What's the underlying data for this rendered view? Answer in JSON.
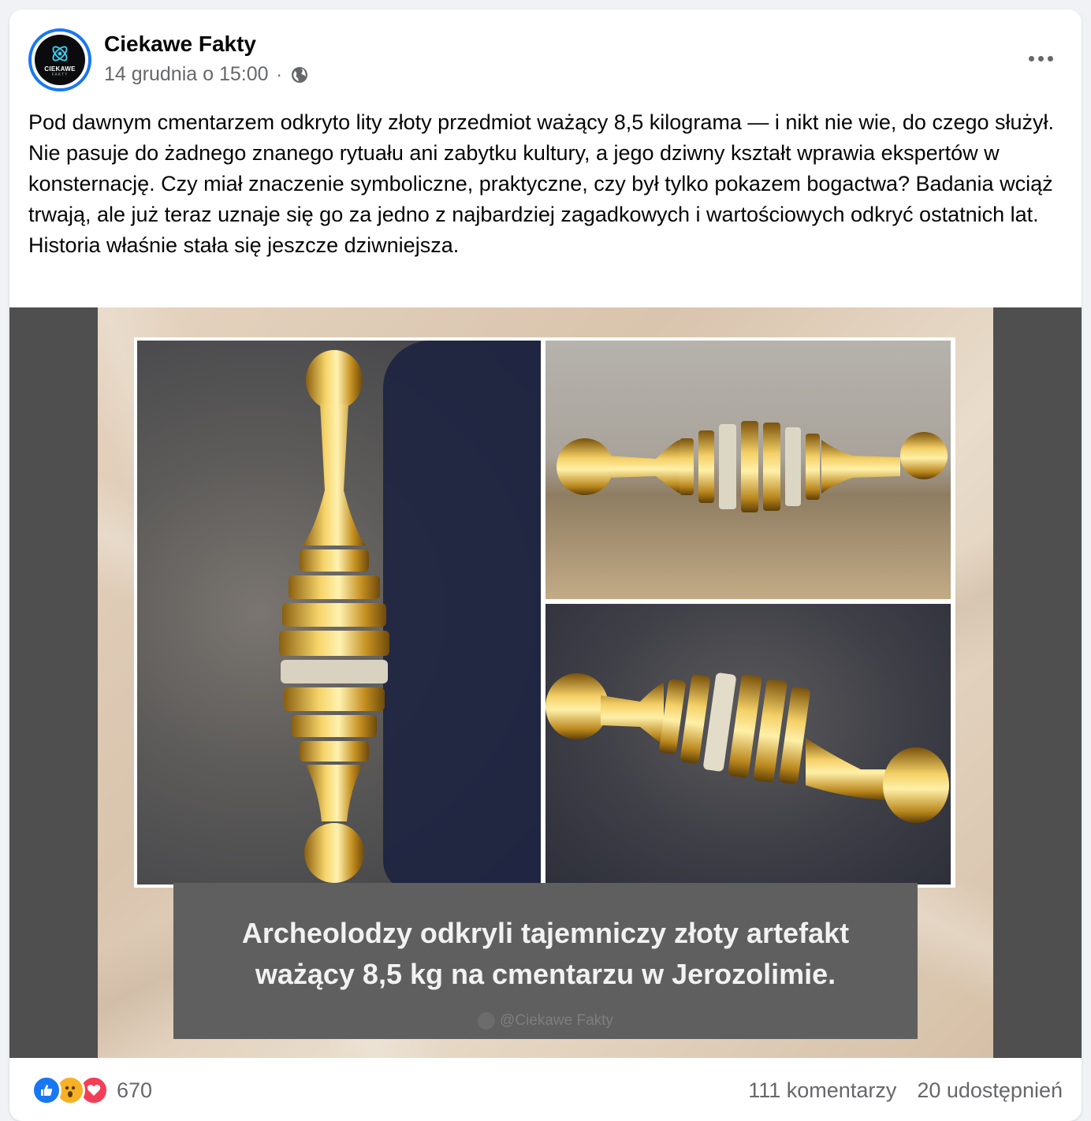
{
  "post": {
    "author": "Ciekawe Fakty",
    "avatar_text": "CIEKAWE",
    "avatar_subtext": "FAKTY",
    "timestamp": "14 grudnia o 15:00",
    "separator": "·",
    "audience_icon": "globe-icon",
    "more_icon": "more-options-icon",
    "text": "Pod dawnym cmentarzem odkryto lity złoty przedmiot ważący 8,5 kilograma — i nikt nie wie, do czego służył. Nie pasuje do żadnego znanego rytuału ani zabytku kultury, a jego dziwny kształt wprawia ekspertów w konsternację. Czy miał znaczenie symboliczne, praktyczne, czy był tylko pokazem bogactwa? Badania wciąż trwają, ale już teraz uznaje się go za jedno z najbardziej zagadkowych i wartościowych odkryć ostatnich lat. Historia właśnie stała się jeszcze dziwniejsza."
  },
  "image": {
    "caption": "Archeolodzy odkryli tajemniczy złoty artefakt ważący 8,5 kg na cmentarzu w Jerozolimie.",
    "watermark": "@Ciekawe Fakty"
  },
  "footer": {
    "reaction_icons": [
      "like-icon",
      "wow-icon",
      "love-icon"
    ],
    "reaction_count": "670",
    "comments": "111 komentarzy",
    "shares": "20 udostępnień"
  },
  "colors": {
    "accent": "#1877f2",
    "secondary_text": "#65676b",
    "gold": "#d9a826"
  }
}
